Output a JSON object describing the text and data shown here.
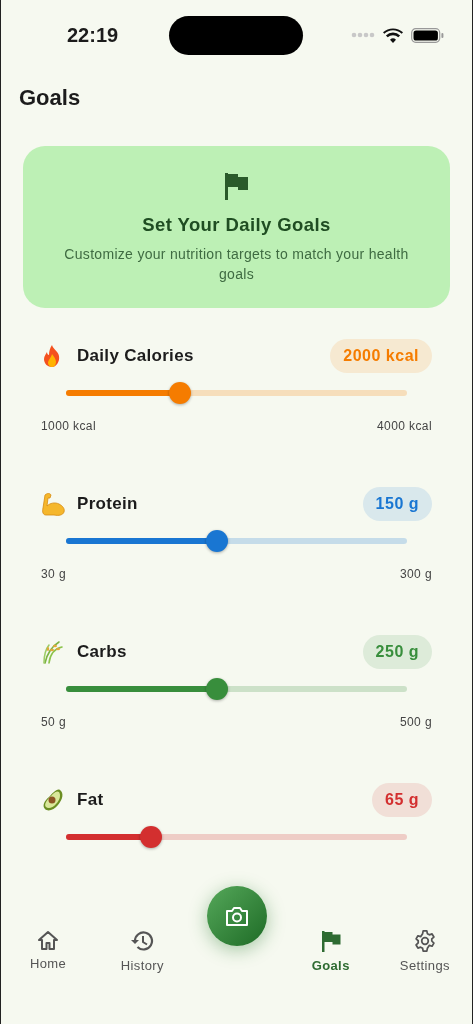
{
  "status_bar": {
    "time": "22:19"
  },
  "page": {
    "title": "Goals"
  },
  "intro_card": {
    "title": "Set Your Daily Goals",
    "text": "Customize your nutrition targets to match your health goals"
  },
  "goals": [
    {
      "name": "Daily Calories",
      "value": "2000 kcal",
      "min": "1000 kcal",
      "max": "4000 kcal",
      "level": 0.333,
      "color": "#f57c00"
    },
    {
      "name": "Protein",
      "value": "150 g",
      "min": "30 g",
      "max": "300 g",
      "level": 0.444,
      "color": "#1976d2"
    },
    {
      "name": "Carbs",
      "value": "250 g",
      "min": "50 g",
      "max": "500 g",
      "level": 0.444,
      "color": "#388e3c"
    },
    {
      "name": "Fat",
      "value": "65 g",
      "level": 0.25,
      "color": "#d32f2f"
    }
  ],
  "bottom_nav": [
    {
      "label": "Home",
      "selected": false
    },
    {
      "label": "History",
      "selected": false
    },
    {
      "label": "Goals",
      "selected": true
    },
    {
      "label": "Settings",
      "selected": false
    }
  ]
}
